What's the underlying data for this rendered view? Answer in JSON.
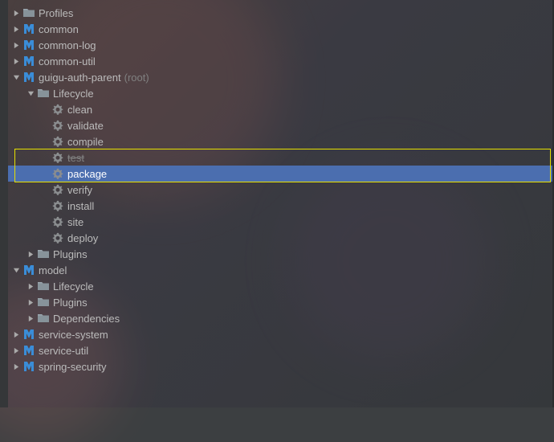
{
  "tree": [
    {
      "depth": 0,
      "arrow": "right",
      "icon": "folder",
      "label": "Profiles"
    },
    {
      "depth": 0,
      "arrow": "right",
      "icon": "maven",
      "label": "common"
    },
    {
      "depth": 0,
      "arrow": "right",
      "icon": "maven",
      "label": "common-log"
    },
    {
      "depth": 0,
      "arrow": "right",
      "icon": "maven",
      "label": "common-util"
    },
    {
      "depth": 0,
      "arrow": "down",
      "icon": "maven",
      "label": "guigu-auth-parent",
      "hint": "(root)"
    },
    {
      "depth": 1,
      "arrow": "down",
      "icon": "folder",
      "label": "Lifecycle"
    },
    {
      "depth": 2,
      "arrow": "none",
      "icon": "gear",
      "label": "clean"
    },
    {
      "depth": 2,
      "arrow": "none",
      "icon": "gear",
      "label": "validate"
    },
    {
      "depth": 2,
      "arrow": "none",
      "icon": "gear",
      "label": "compile"
    },
    {
      "depth": 2,
      "arrow": "none",
      "icon": "gear",
      "label": "test",
      "struck": true,
      "boxed_top": true
    },
    {
      "depth": 2,
      "arrow": "none",
      "icon": "gear",
      "label": "package",
      "selected": true,
      "boxed_bottom": true
    },
    {
      "depth": 2,
      "arrow": "none",
      "icon": "gear",
      "label": "verify"
    },
    {
      "depth": 2,
      "arrow": "none",
      "icon": "gear",
      "label": "install"
    },
    {
      "depth": 2,
      "arrow": "none",
      "icon": "gear",
      "label": "site"
    },
    {
      "depth": 2,
      "arrow": "none",
      "icon": "gear",
      "label": "deploy"
    },
    {
      "depth": 1,
      "arrow": "right",
      "icon": "folder",
      "label": "Plugins"
    },
    {
      "depth": 0,
      "arrow": "down",
      "icon": "maven",
      "label": "model"
    },
    {
      "depth": 1,
      "arrow": "right",
      "icon": "folder",
      "label": "Lifecycle"
    },
    {
      "depth": 1,
      "arrow": "right",
      "icon": "folder",
      "label": "Plugins"
    },
    {
      "depth": 1,
      "arrow": "right",
      "icon": "folder",
      "label": "Dependencies"
    },
    {
      "depth": 0,
      "arrow": "right",
      "icon": "maven",
      "label": "service-system"
    },
    {
      "depth": 0,
      "arrow": "right",
      "icon": "maven",
      "label": "service-util"
    },
    {
      "depth": 0,
      "arrow": "right",
      "icon": "maven",
      "label": "spring-security"
    }
  ],
  "colors": {
    "selected_bg": "#4b6eaf",
    "highlight_border": "#e6e000",
    "maven_icon": "#3a8dd8",
    "gear_icon": "#8a8d8f",
    "folder_icon": "#87939a"
  }
}
